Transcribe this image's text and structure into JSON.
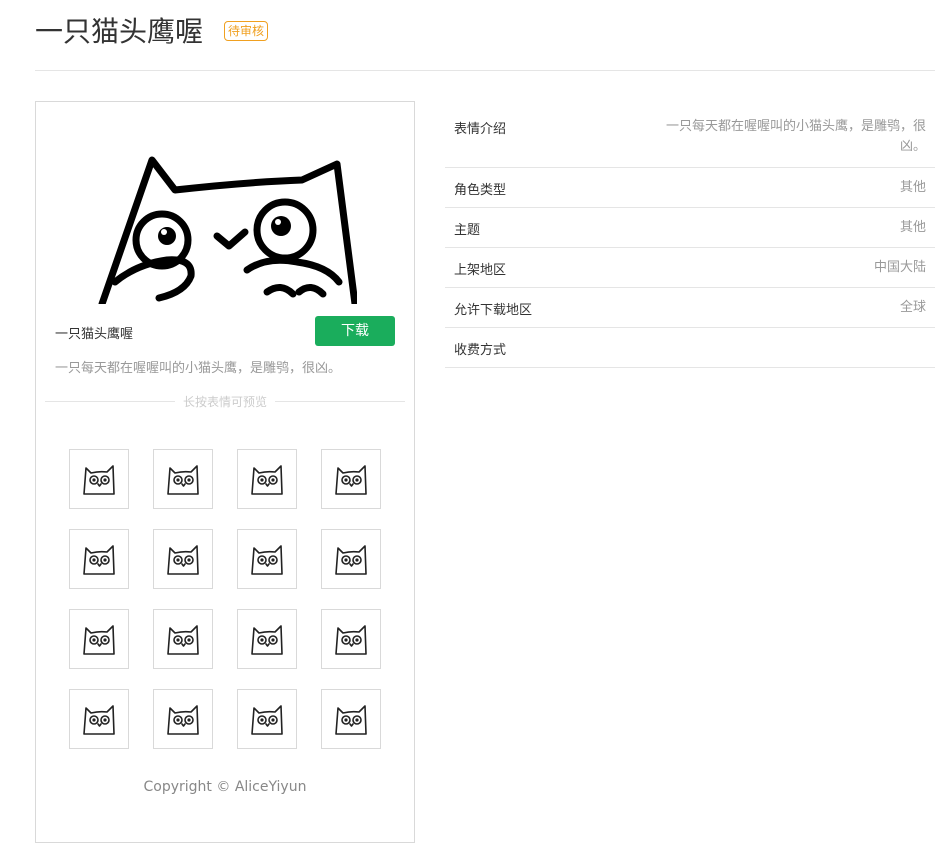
{
  "header": {
    "title": "一只猫头鹰喔",
    "badge": "待审核"
  },
  "pack": {
    "name": "一只猫头鹰喔",
    "download_label": "下载",
    "description": "一只每天都在喔喔叫的小猫头鹰，是雕鸮，很凶。",
    "preview_hint": "长按表情可预览"
  },
  "stickers": [
    "sticker-owl-heart",
    "sticker-owl-plain",
    "sticker-owl-dots",
    "sticker-owl-exclaim",
    "sticker-owl-grumpy",
    "sticker-owl-talk",
    "sticker-owl-blob",
    "sticker-owl-pair",
    "sticker-owl-wink",
    "sticker-owl-smile",
    "sticker-owl-flower",
    "sticker-owl-bloom",
    "sticker-owl-spark",
    "sticker-owl-wings",
    "sticker-owl-crown",
    "sticker-owl-book"
  ],
  "copyright": "Copyright © AliceYiyun",
  "details": [
    {
      "key": "表情介绍",
      "value": "一只每天都在喔喔叫的小猫头鹰，是雕鸮，很凶。"
    },
    {
      "key": "角色类型",
      "value": "其他"
    },
    {
      "key": "主题",
      "value": "其他"
    },
    {
      "key": "上架地区",
      "value": "中国大陆"
    },
    {
      "key": "允许下载地区",
      "value": "全球"
    },
    {
      "key": "收费方式",
      "value": ""
    }
  ],
  "colors": {
    "accent": "#1aad5c",
    "badge": "#f0a020"
  }
}
